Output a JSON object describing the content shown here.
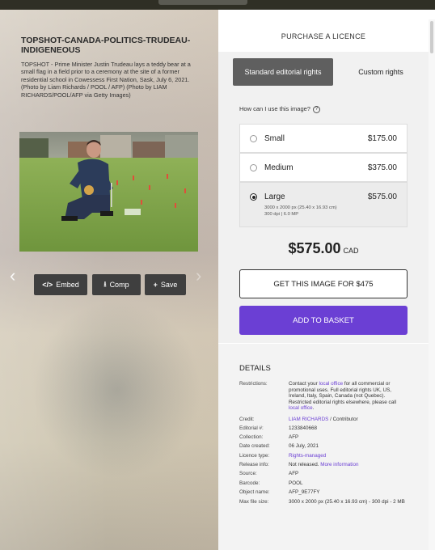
{
  "photo": {
    "title": "TOPSHOT-CANADA-POLITICS-TRUDEAU-INDIGENEOUS",
    "caption": "TOPSHOT - Prime Minister Justin Trudeau lays a teddy bear at a small flag in a field prior to a ceremony at the site of a former residential school in Cowessess First Nation, Sask, July 6, 2021. (Photo by Liam Richards / POOL / AFP) (Photo by LIAM RICHARDS/POOL/AFP via Getty Images)"
  },
  "tools": {
    "embed_label": "Embed",
    "comp_label": "Comp",
    "save_label": "Save"
  },
  "purchase": {
    "header": "PURCHASE A LICENCE",
    "tab_standard": "Standard editorial rights",
    "tab_custom": "Custom rights",
    "question": "How can I use this image?",
    "sizes": [
      {
        "name": "Small",
        "price": "$175.00"
      },
      {
        "name": "Medium",
        "price": "$375.00"
      },
      {
        "name": "Large",
        "price": "$575.00",
        "details_1": "3000 x 2000 px (25.40 x 16.93 cm)",
        "details_2": "300 dpi | 6.0 MP"
      }
    ],
    "selected_size": "Large",
    "total": "$575.00",
    "currency": "CAD",
    "get_image_label": "GET THIS IMAGE FOR $475",
    "add_basket_label": "ADD TO BASKET",
    "accent_color": "#6b3fd4"
  },
  "details": {
    "header": "DETAILS",
    "restrictions_key": "Restrictions:",
    "restrictions_pre": "Contact your ",
    "restrictions_link1": "local office",
    "restrictions_mid": " for all commercial or promotional uses. Full editorial rights UK, US, Ireland, Italy, Spain, Canada (not Quebec). Restricted editorial rights elsewhere, please call ",
    "restrictions_link2": "local office",
    "restrictions_post": ".",
    "rows": [
      {
        "key": "Credit:",
        "value": "LIAM RICHARDS",
        "suffix": " / Contributor"
      },
      {
        "key": "Editorial #:",
        "value": "1233840668"
      },
      {
        "key": "Collection:",
        "value": "AFP"
      },
      {
        "key": "Date created:",
        "value": "06 July, 2021"
      },
      {
        "key": "Licence type:",
        "value": "Rights-managed"
      },
      {
        "key": "Release info:",
        "value": "Not released.",
        "link": "More information"
      },
      {
        "key": "Source:",
        "value": "AFP"
      },
      {
        "key": "Barcode:",
        "value": "POOL"
      },
      {
        "key": "Object name:",
        "value": "AFP_9E77FY"
      },
      {
        "key": "Max file size:",
        "value": "3000 x 2000 px (25.40 x 16.93 cm) - 300 dpi - 2 MB"
      }
    ]
  }
}
